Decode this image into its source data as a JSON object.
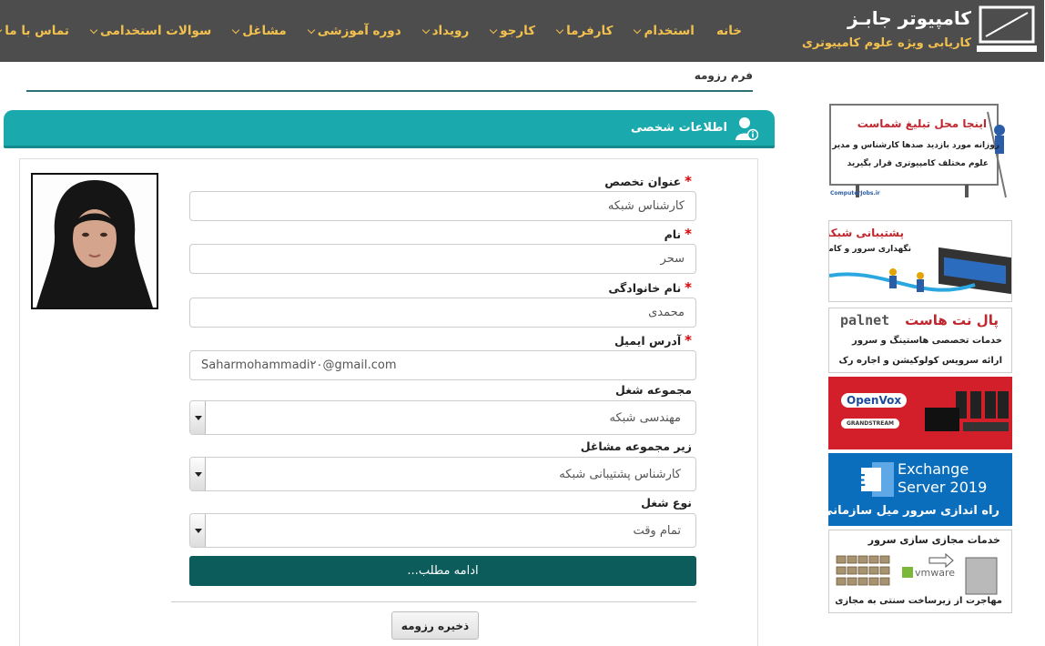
{
  "brand": {
    "title": "کامپیوتر جابـز",
    "subtitle": "کاریابی ویژه علوم کامپیوتری"
  },
  "nav": {
    "items": [
      {
        "label": "خانه",
        "has_menu": false
      },
      {
        "label": "استخدام",
        "has_menu": true
      },
      {
        "label": "کارفرما",
        "has_menu": true
      },
      {
        "label": "کارجو",
        "has_menu": true
      },
      {
        "label": "رویداد",
        "has_menu": true
      },
      {
        "label": "دوره آموزشی",
        "has_menu": true
      },
      {
        "label": "مشاغل",
        "has_menu": true
      },
      {
        "label": "سوالات استخدامی",
        "has_menu": true
      },
      {
        "label": "تماس با ما",
        "has_menu": true
      }
    ]
  },
  "page": {
    "caption": "فرم رزومه",
    "section_title": "اطلاعات شخصی"
  },
  "form": {
    "specialty_label": "عنوان تخصص",
    "specialty_value": "کارشناس شبکه",
    "first_name_label": "نام",
    "first_name_value": "سحر",
    "last_name_label": "نام خانوادگی",
    "last_name_value": "محمدی",
    "email_label": "آدرس ایمیل",
    "email_value": "Saharmohammadi۲۰@gmail.com",
    "job_group_label": "مجموعه شغل",
    "job_group_value": "مهندسی شبکه",
    "sub_group_label": "زیر مجموعه مشاغل",
    "sub_group_value": "کارشناس پشتیبانی شبکه",
    "job_type_label": "نوع شغل",
    "job_type_value": "تمام وقت",
    "required_mark": "*",
    "more_button": "ادامه مطلب...",
    "save_button": "ذخیره رزومه"
  },
  "ads": {
    "ad1_title": "اینجا محل تبلیغ شماست",
    "ad1_line1": "روزانه مورد بازدید صدها کارشناس و مدیر",
    "ad1_line2": "علوم مختلف کامپیوتری قرار بگیرید",
    "ad1_site": "ComputerJobs.ir",
    "ad2_title": "پشتیبانی شبکه",
    "ad2_sub": "نگهداری سرور و کامپیوتر",
    "ad3_logo": "palnet",
    "ad3_title": "پال نت هاست",
    "ad3_line1": "خدمات تخصصی هاستینگ و سرور",
    "ad3_line2": "ارائه سرویس کولوکیشن و اجاره رک",
    "ad4_brand1": "OpenVox",
    "ad4_brand2": "GRANDSTREAM",
    "ad5_line1": "Exchange",
    "ad5_line2": "Server 2019",
    "ad5_sub": "راه اندازی سرور میل سازمانی",
    "ad6_title": "خدمات مجازی سازی سرور",
    "ad6_brand": "vmware",
    "ad6_sub": "مهاجرت از زیرساخت سنتی به مجازی"
  },
  "colors": {
    "topbar": "#4d4d4d",
    "nav_text": "#f2c14e",
    "section": "#1aa9ad",
    "primary_button": "#0d5c5c",
    "required": "#dd0000"
  }
}
